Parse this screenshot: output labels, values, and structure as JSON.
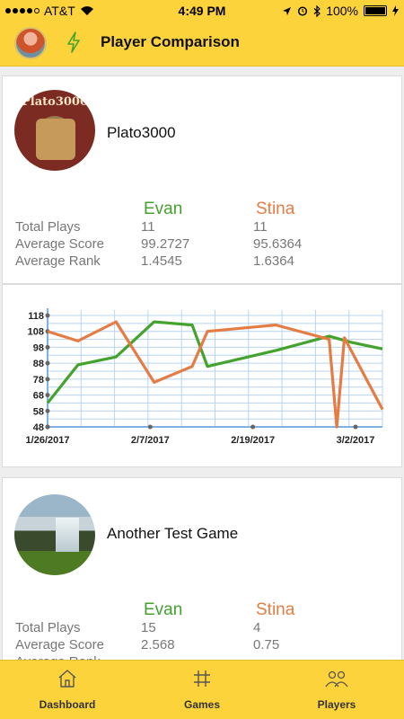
{
  "status_bar": {
    "carrier": "AT&T",
    "time": "4:49 PM",
    "battery": "100%"
  },
  "header": {
    "title": "Player Comparison"
  },
  "players": {
    "p1": "Evan",
    "p2": "Stina"
  },
  "stat_labels": [
    "Total Plays",
    "Average Score",
    "Average Rank"
  ],
  "games": [
    {
      "name": "Plato3000",
      "thumb_text": "Plato3000",
      "stats": {
        "plays": [
          "11",
          "11"
        ],
        "avg_score": [
          "99.2727",
          "95.6364"
        ],
        "avg_rank": [
          "1.4545",
          "1.6364"
        ]
      }
    },
    {
      "name": "Another Test Game",
      "stats": {
        "plays": [
          "15",
          "4"
        ],
        "avg_score": [
          "2.568",
          "0.75"
        ],
        "avg_rank": [
          "",
          ""
        ]
      }
    }
  ],
  "chart_data": {
    "type": "line",
    "y_ticks": [
      "118",
      "108",
      "98",
      "88",
      "78",
      "68",
      "58",
      "48"
    ],
    "ylim": [
      48,
      118
    ],
    "x_ticks": [
      "1/26/2017",
      "2/7/2017",
      "2/19/2017",
      "3/2/2017"
    ],
    "xlim": [
      0,
      44
    ],
    "grid": true,
    "series": [
      {
        "name": "Evan",
        "color": "#43a32c",
        "x": [
          0,
          4,
          9,
          14,
          19,
          21,
          30,
          37,
          40,
          44
        ],
        "y": [
          63,
          87,
          92,
          114,
          112,
          86,
          96,
          105,
          101,
          97
        ]
      },
      {
        "name": "Stina",
        "color": "#e57c44",
        "x": [
          0,
          4,
          9,
          14,
          19,
          21,
          30,
          37,
          38,
          39,
          44
        ],
        "y": [
          108,
          102,
          114,
          76,
          86,
          108,
          112,
          103,
          48,
          104,
          59
        ]
      }
    ]
  },
  "tabs": [
    {
      "label": "Dashboard",
      "icon": "home-icon"
    },
    {
      "label": "Games",
      "icon": "hash-icon"
    },
    {
      "label": "Players",
      "icon": "players-icon"
    }
  ]
}
